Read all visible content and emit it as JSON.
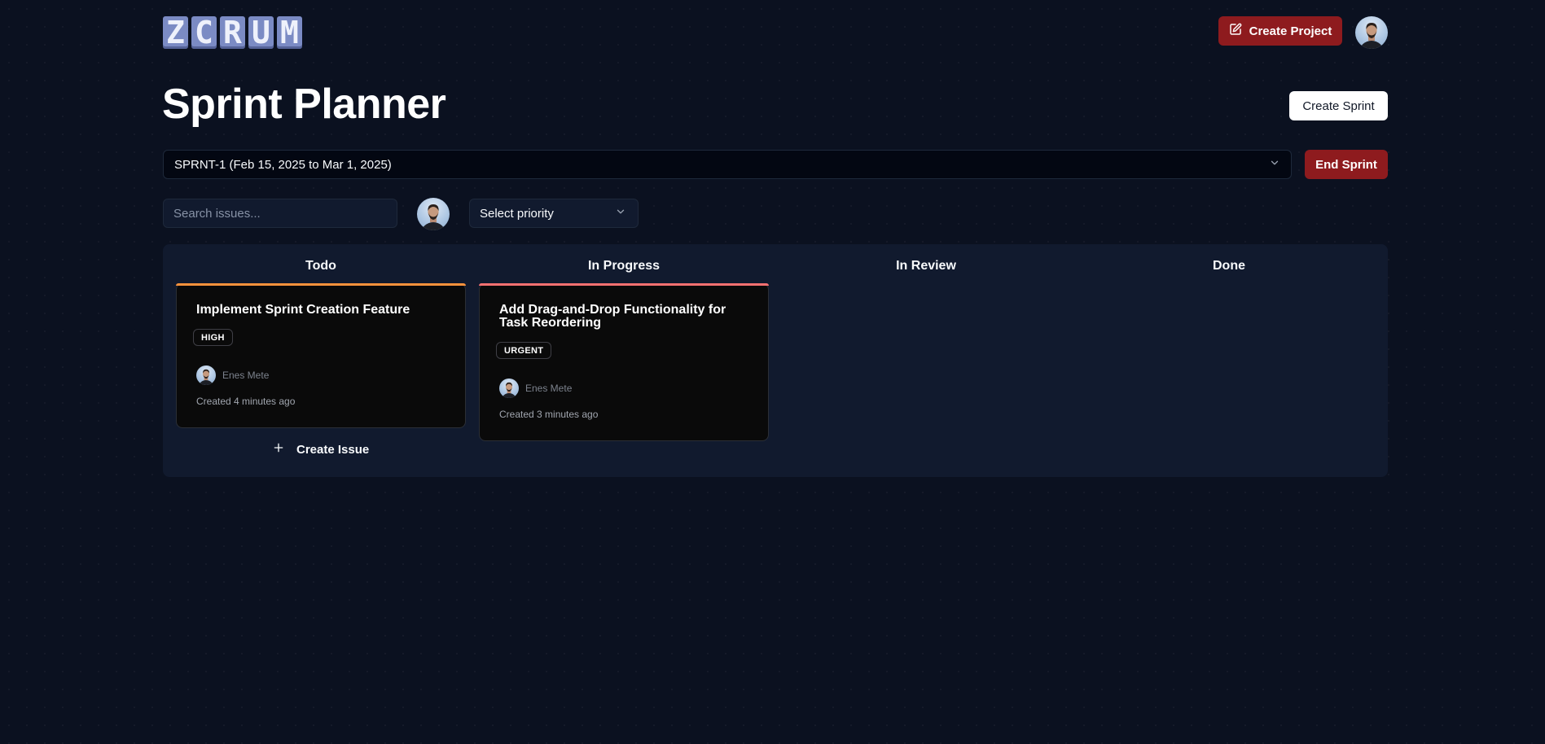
{
  "app": {
    "logo_letters": [
      "Z",
      "C",
      "R",
      "U",
      "M"
    ]
  },
  "header": {
    "create_project_label": "Create Project",
    "avatar_icon": "user-avatar-icon"
  },
  "page": {
    "title": "Sprint Planner",
    "create_sprint_label": "Create Sprint"
  },
  "sprint": {
    "selected": "SPRNT-1 (Feb 15, 2025 to Mar 1, 2025)",
    "end_sprint_label": "End Sprint"
  },
  "filters": {
    "search_placeholder": "Search issues...",
    "search_value": "",
    "priority_selected": "Select priority"
  },
  "board": {
    "columns": [
      {
        "title": "Todo"
      },
      {
        "title": "In Progress"
      },
      {
        "title": "In Review"
      },
      {
        "title": "Done"
      }
    ],
    "cards": [
      {
        "title": "Implement Sprint Creation Feature",
        "priority": "HIGH",
        "priority_color": "#fb923c",
        "assignee": "Enes Mete",
        "created": "Created 4 minutes ago"
      },
      {
        "title": "Add Drag-and-Drop Functionality for Task Reordering",
        "priority": "URGENT",
        "priority_color": "#f87171",
        "assignee": "Enes Mete",
        "created": "Created 3 minutes ago"
      }
    ],
    "create_issue_label": "Create Issue"
  },
  "colors": {
    "background": "#0b1120",
    "accent_red": "#8e1b1e",
    "logo": "#7b8bc4"
  }
}
